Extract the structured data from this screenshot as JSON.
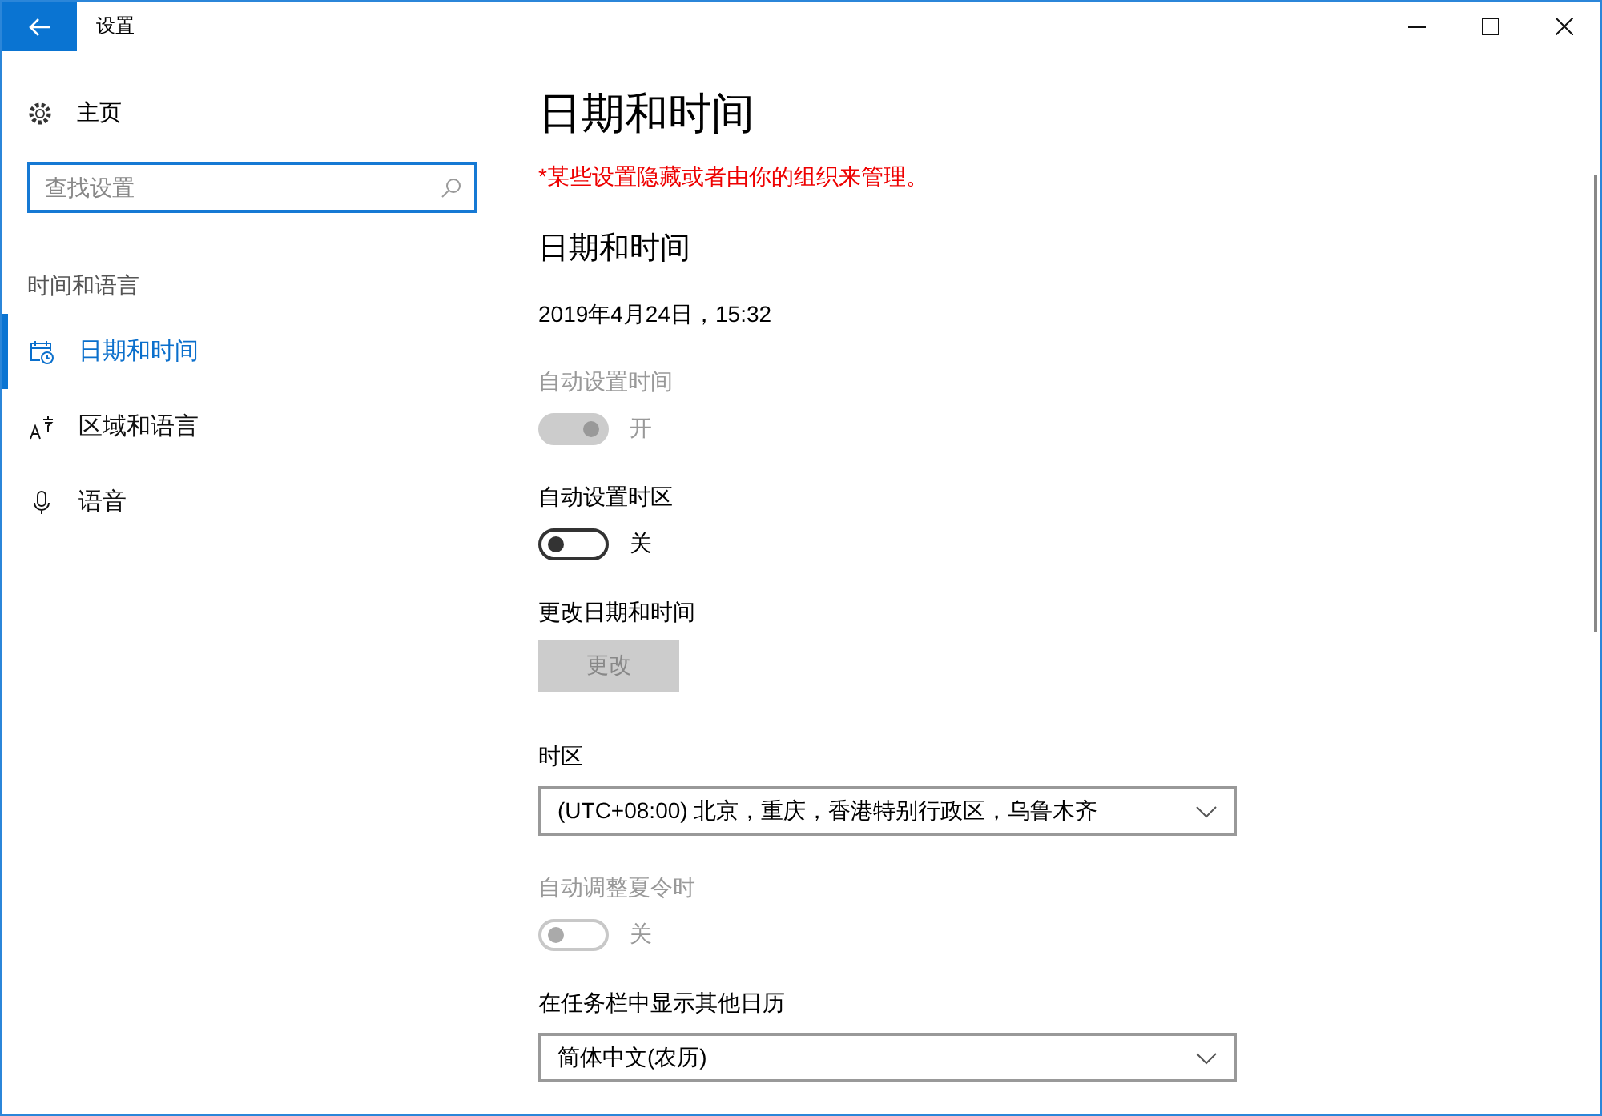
{
  "window": {
    "title": "设置"
  },
  "sidebar": {
    "home": "主页",
    "search": {
      "placeholder": "查找设置"
    },
    "section": "时间和语言",
    "items": [
      {
        "label": "日期和时间",
        "selected": true
      },
      {
        "label": "区域和语言",
        "selected": false
      },
      {
        "label": "语音",
        "selected": false
      }
    ]
  },
  "page": {
    "title": "日期和时间",
    "notice": "*某些设置隐藏或者由你的组织来管理。",
    "section": "日期和时间",
    "settings": [
      {
        "kind": "text",
        "value": "2019年4月24日，15:32"
      },
      {
        "kind": "toggle",
        "label": "自动设置时间",
        "on": true,
        "disabled": true,
        "state_text": "开"
      },
      {
        "kind": "toggle",
        "label": "自动设置时区",
        "on": false,
        "disabled": false,
        "state_text": "关"
      },
      {
        "kind": "button",
        "label": "更改日期和时间",
        "button": "更改",
        "disabled": true
      },
      {
        "kind": "dropdown",
        "label": "时区",
        "value": "(UTC+08:00) 北京，重庆，香港特别行政区，乌鲁木齐"
      },
      {
        "kind": "toggle",
        "label": "自动调整夏令时",
        "on": false,
        "disabled": true,
        "state_text": "关"
      },
      {
        "kind": "dropdown",
        "label": "在任务栏中显示其他日历",
        "value": "简体中文(农历)"
      }
    ]
  }
}
